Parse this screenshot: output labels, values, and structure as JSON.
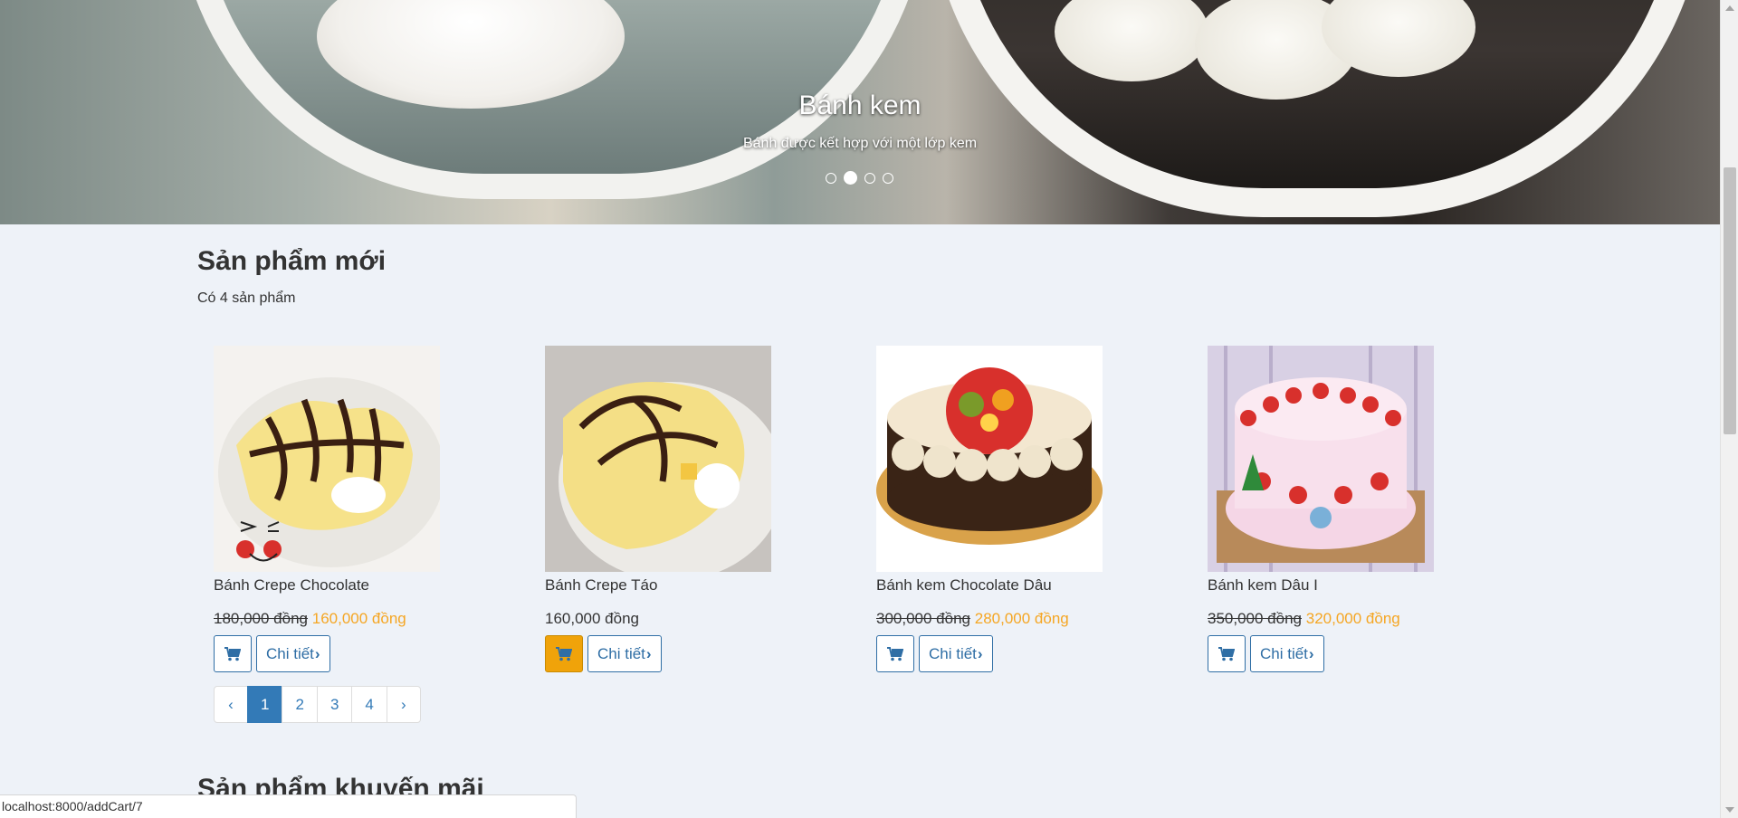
{
  "hero": {
    "title": "Bánh kem",
    "subtitle": "Bánh được kết hợp với một lớp kem",
    "indicators": 4,
    "active_indicator": 1
  },
  "section_new": {
    "title": "Sản phẩm mới",
    "count_text": "Có 4 sản phẩm"
  },
  "products": [
    {
      "name": "Bánh Crepe Chocolate",
      "old_price": "180,000 đồng",
      "price": "160,000 đồng",
      "detail_label": "Chi tiết"
    },
    {
      "name": "Bánh Crepe Táo",
      "old_price": "",
      "price": "160,000 đồng",
      "detail_label": "Chi tiết"
    },
    {
      "name": "Bánh kem Chocolate Dâu",
      "old_price": "300,000 đồng",
      "price": "280,000 đồng",
      "detail_label": "Chi tiết"
    },
    {
      "name": "Bánh kem Dâu I",
      "old_price": "350,000 đồng",
      "price": "320,000 đồng",
      "detail_label": "Chi tiết"
    }
  ],
  "pagination": {
    "prev": "‹",
    "pages": [
      "1",
      "2",
      "3",
      "4"
    ],
    "active_page": "1",
    "next": "›"
  },
  "section_promo": {
    "title": "Sản phẩm khuyến mãi"
  },
  "statusbar": {
    "url": "localhost:8000/addCart/7"
  },
  "colors": {
    "accent": "#337ab7",
    "sale_price": "#f5a623",
    "cart_hover": "#f0a30a"
  },
  "icons": {
    "cart": "shopping-cart-icon",
    "chevron": "chevron-right-icon"
  }
}
